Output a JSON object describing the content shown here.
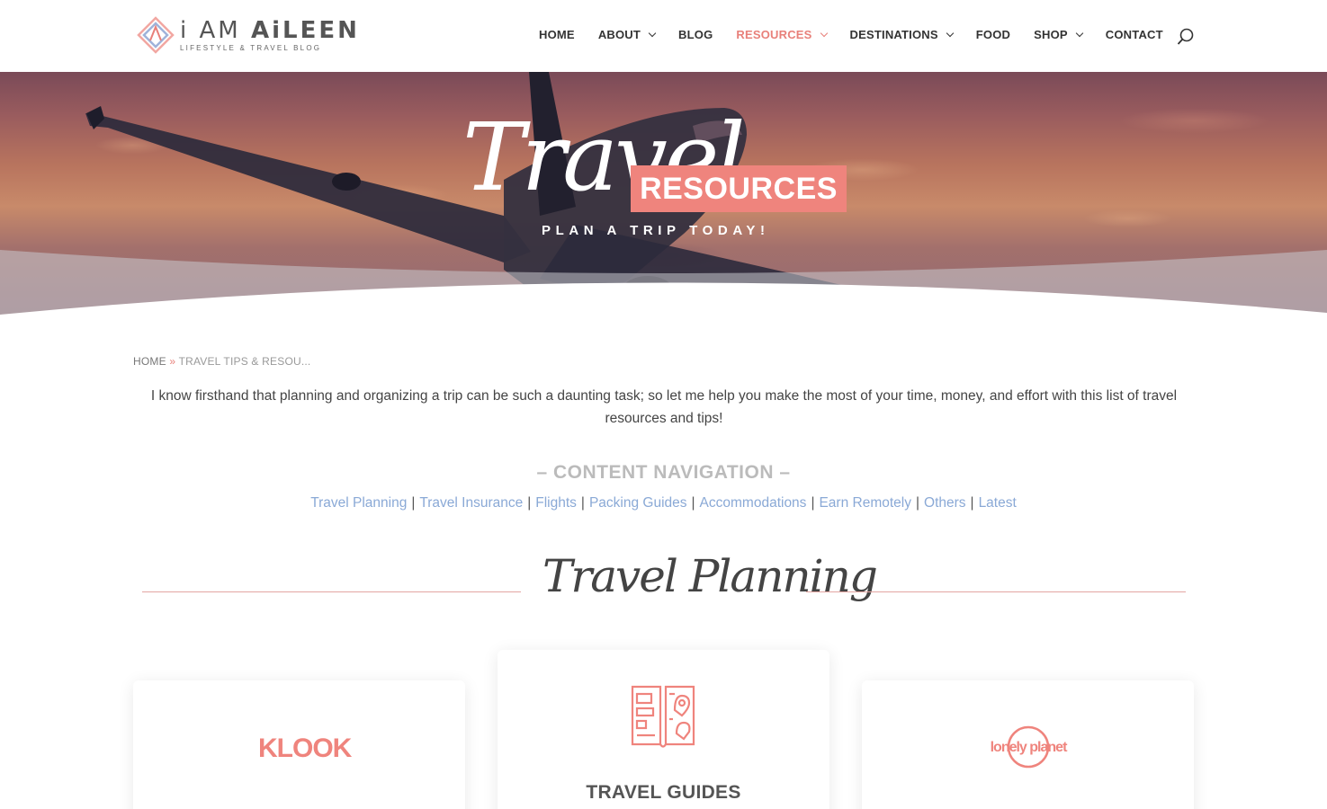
{
  "header": {
    "logo_title_prefix": "i AM ",
    "logo_title_name": "AiLEEN",
    "logo_subtitle": "LIFESTYLE & TRAVEL BLOG",
    "nav": [
      {
        "label": "HOME",
        "dropdown": false
      },
      {
        "label": "ABOUT",
        "dropdown": true
      },
      {
        "label": "BLOG",
        "dropdown": false
      },
      {
        "label": "RESOURCES",
        "dropdown": true,
        "active": true
      },
      {
        "label": "DESTINATIONS",
        "dropdown": true
      },
      {
        "label": "FOOD",
        "dropdown": false
      },
      {
        "label": "SHOP",
        "dropdown": true
      },
      {
        "label": "CONTACT",
        "dropdown": false
      }
    ],
    "search_icon": "search-icon"
  },
  "hero": {
    "script_text": "Travel",
    "badge_text": "RESOURCES",
    "subtitle": "PLAN A TRIP TODAY!"
  },
  "breadcrumb": {
    "home": "HOME",
    "separator": "»",
    "current": "TRAVEL TIPS & RESOU..."
  },
  "intro": "I know firsthand that planning and organizing a trip can be such a daunting task; so let me help you make the most of your time, money, and effort with this list of travel resources and tips!",
  "content_navigation": {
    "title": "– CONTENT NAVIGATION –",
    "links": [
      "Travel Planning",
      "Travel Insurance",
      "Flights",
      "Packing Guides",
      "Accommodations",
      "Earn Remotely",
      "Others",
      "Latest"
    ]
  },
  "section": {
    "title": "Travel Planning"
  },
  "cards": {
    "klook_logo": "KLOOK",
    "travel_guides_title": "TRAVEL GUIDES",
    "lonely_planet_logo": "lonely planet"
  },
  "colors": {
    "accent": "#ef847d",
    "link": "#8aa9d6",
    "nav_active": "#e8807a"
  }
}
